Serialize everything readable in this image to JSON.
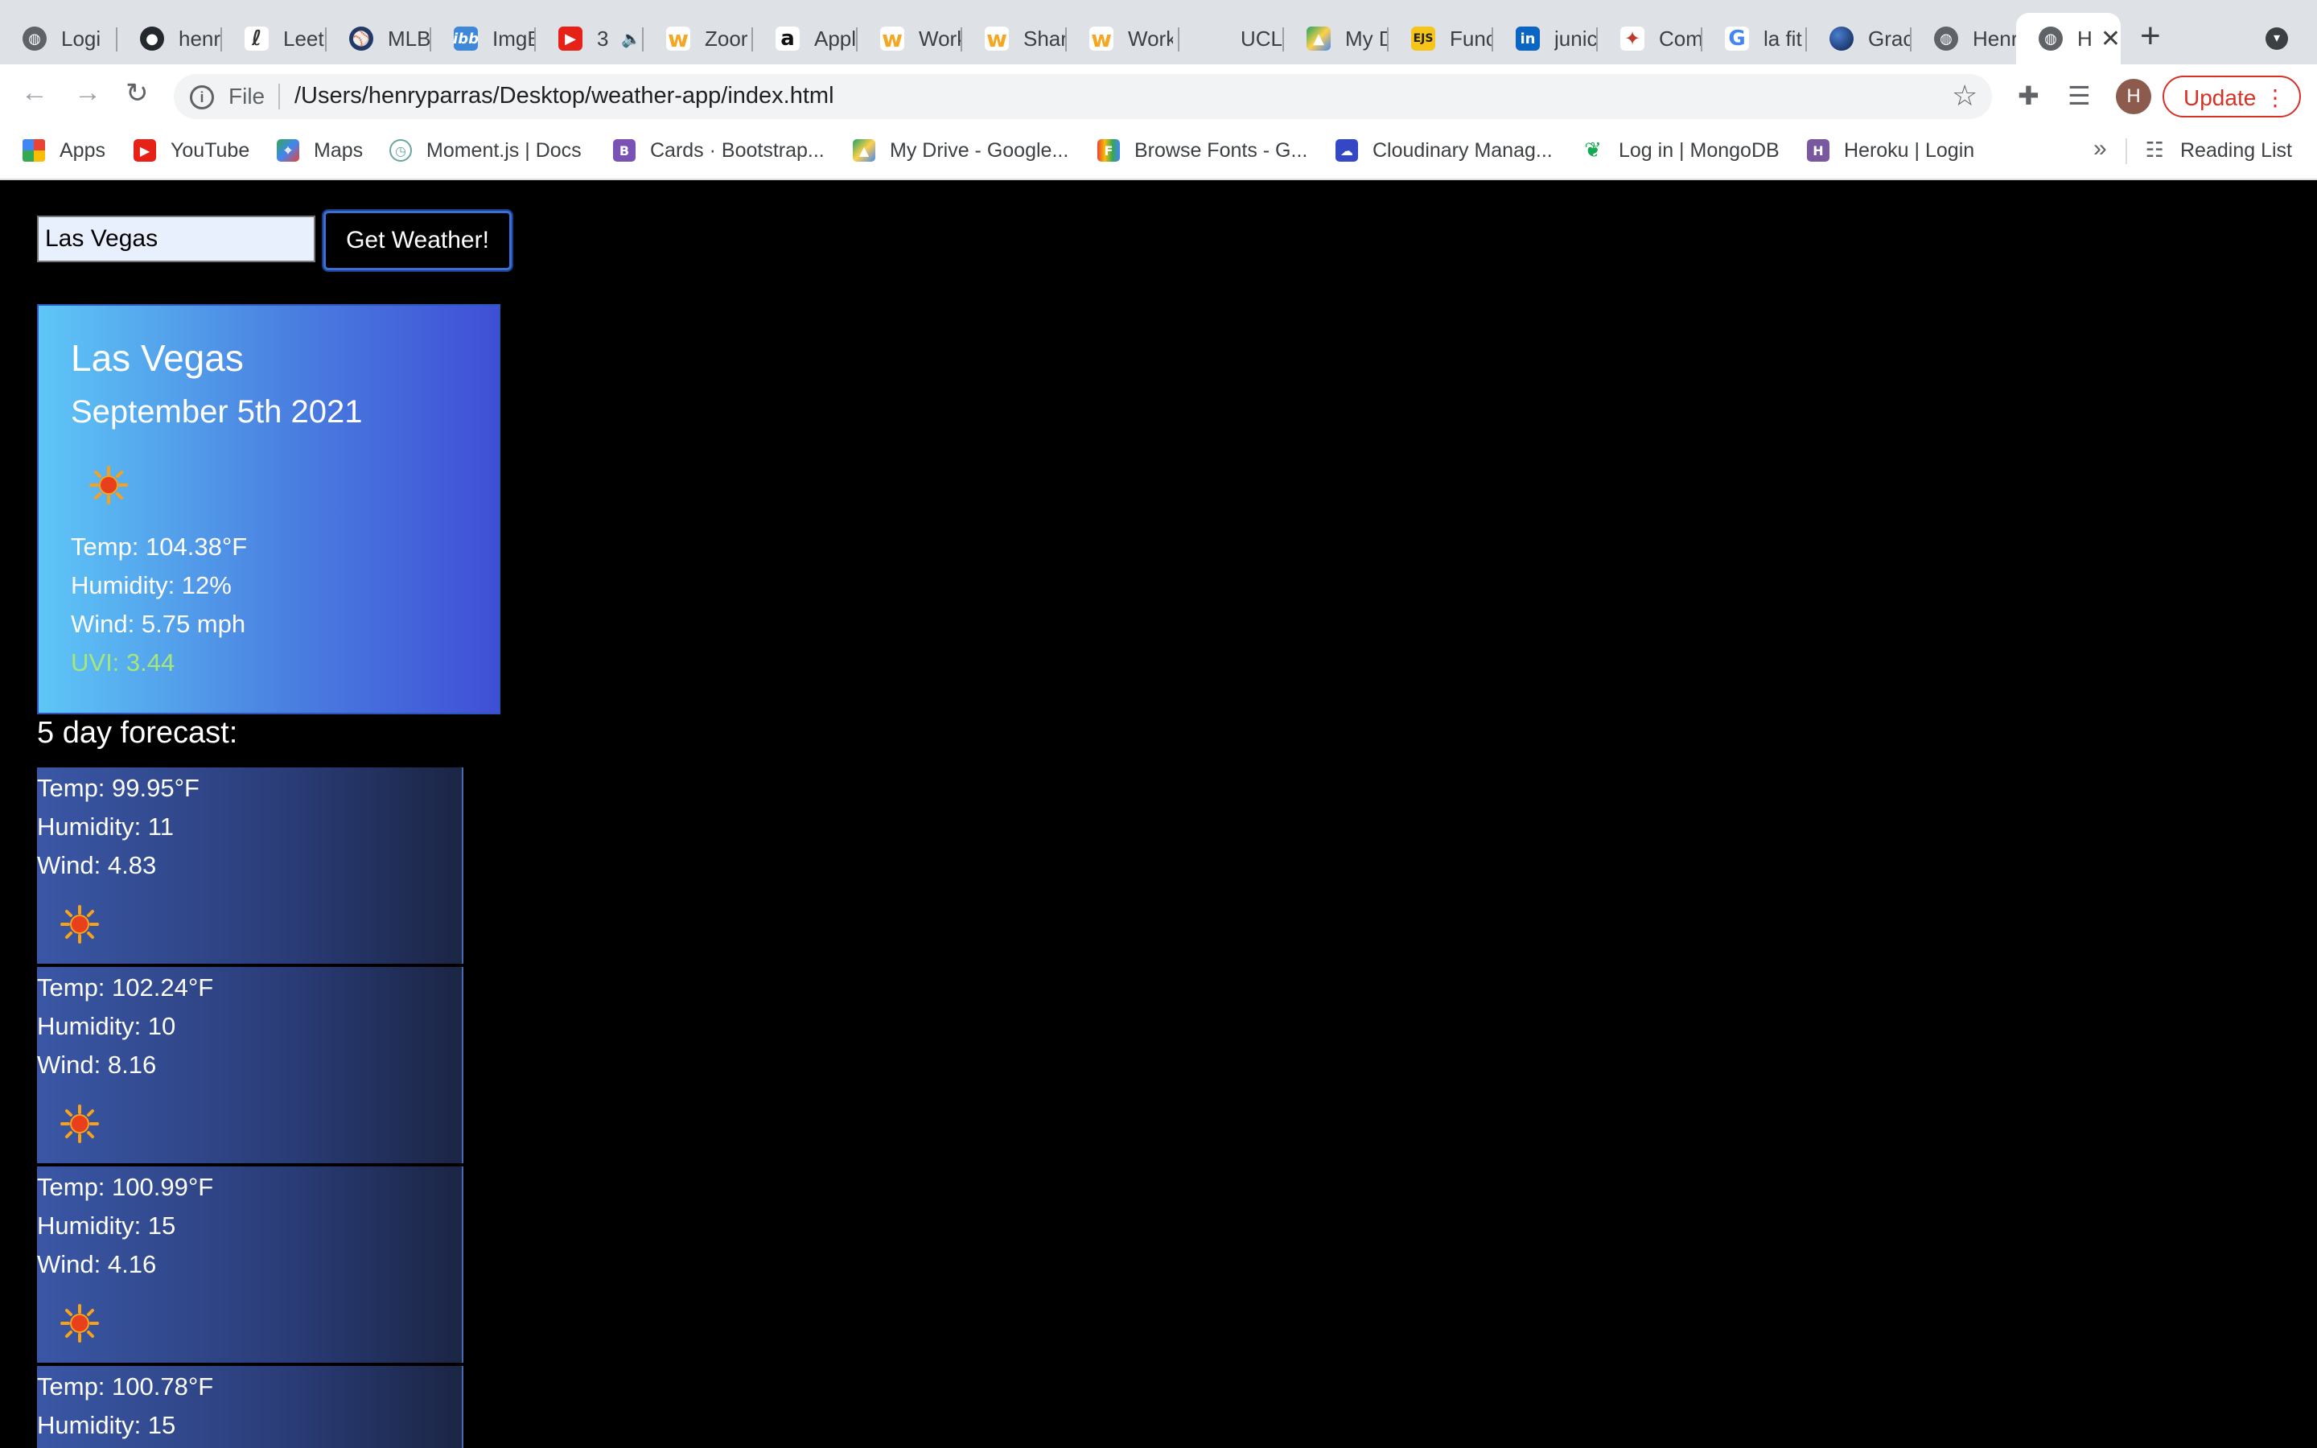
{
  "browser": {
    "tabs": [
      {
        "title": "Logi",
        "icon": "globe-icon"
      },
      {
        "title": "henr",
        "icon": "github-icon"
      },
      {
        "title": "Leet",
        "icon": "leetcode-icon"
      },
      {
        "title": "MLB",
        "icon": "mlb-icon"
      },
      {
        "title": "ImgB",
        "icon": "imgbb-icon"
      },
      {
        "title": "3",
        "icon": "youtube-icon"
      },
      {
        "title": "Zoor",
        "icon": "workday-icon"
      },
      {
        "title": "Appl",
        "icon": "amazon-icon"
      },
      {
        "title": "Work",
        "icon": "workday-icon"
      },
      {
        "title": "Shar",
        "icon": "workday-icon"
      },
      {
        "title": "Work",
        "icon": "workday-icon"
      },
      {
        "title": "UCL",
        "icon": "ucla-icon"
      },
      {
        "title": "My D",
        "icon": "google-drive-icon"
      },
      {
        "title": "Func",
        "icon": "ejs-icon"
      },
      {
        "title": "junic",
        "icon": "linkedin-icon"
      },
      {
        "title": "Com",
        "icon": "bird-icon"
      },
      {
        "title": "la fit",
        "icon": "google-icon"
      },
      {
        "title": "Grac",
        "icon": "circle-icon"
      },
      {
        "title": "Henr",
        "icon": "globe-icon"
      },
      {
        "title": "H",
        "icon": "globe-icon"
      }
    ],
    "url_scheme": "File",
    "url": "/Users/henryparras/Desktop/weather-app/index.html",
    "avatar_letter": "H",
    "update_label": "Update",
    "bookmarks": [
      {
        "label": "Apps",
        "icon": "apps-grid-icon"
      },
      {
        "label": "YouTube",
        "icon": "youtube-icon"
      },
      {
        "label": "Maps",
        "icon": "maps-icon"
      },
      {
        "label": "Moment.js | Docs",
        "icon": "clock-icon"
      },
      {
        "label": "Cards · Bootstrap...",
        "icon": "bootstrap-icon"
      },
      {
        "label": "My Drive - Google...",
        "icon": "google-drive-icon"
      },
      {
        "label": "Browse Fonts - G...",
        "icon": "google-fonts-icon"
      },
      {
        "label": "Cloudinary Manag...",
        "icon": "cloudinary-icon"
      },
      {
        "label": "Log in | MongoDB",
        "icon": "mongodb-leaf-icon"
      },
      {
        "label": "Heroku | Login",
        "icon": "heroku-icon"
      }
    ],
    "bookmarks_overflow": "»",
    "reading_list_label": "Reading List"
  },
  "search": {
    "value": "Las Vegas",
    "button_label": "Get Weather!"
  },
  "current": {
    "city": "Las Vegas",
    "date": "September 5th 2021",
    "icon": "sun-icon",
    "temp": "Temp: 104.38°F",
    "humidity": "Humidity: 12%",
    "wind": "Wind: 5.75 mph",
    "uvi": "UVI: 3.44",
    "uvi_color": "#a6e77a"
  },
  "forecast": {
    "heading": "5 day forecast:",
    "days": [
      {
        "temp": "Temp: 99.95°F",
        "humidity": "Humidity: 11",
        "wind": "Wind: 4.83",
        "icon": "sun-icon"
      },
      {
        "temp": "Temp: 102.24°F",
        "humidity": "Humidity: 10",
        "wind": "Wind: 8.16",
        "icon": "sun-icon"
      },
      {
        "temp": "Temp: 100.99°F",
        "humidity": "Humidity: 15",
        "wind": "Wind: 4.16",
        "icon": "sun-icon"
      },
      {
        "temp": "Temp: 100.78°F",
        "humidity": "Humidity: 15",
        "wind": "",
        "icon": "sun-icon"
      }
    ]
  }
}
